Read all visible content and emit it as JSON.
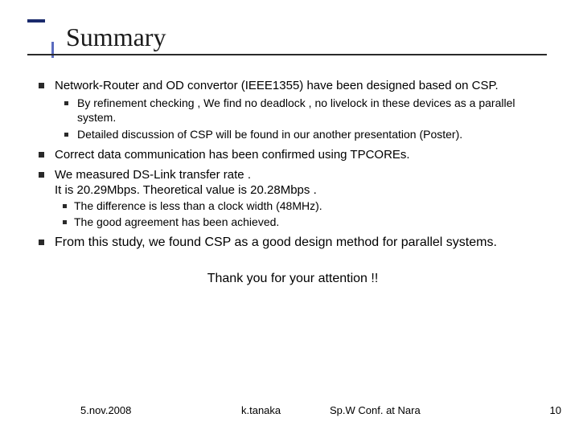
{
  "title": "Summary",
  "bullets": {
    "b1": "Network-Router and OD convertor (IEEE1355) have been designed based on CSP.",
    "b1a": "By refinement checking , We find no deadlock , no livelock in these devices as a parallel system.",
    "b1b": "Detailed discussion of CSP will be found in our another presentation (Poster).",
    "b2": "Correct data communication has been confirmed using TPCOREs.",
    "b3": "We measured DS-Link transfer rate .",
    "b3line2": "It is 20.29Mbps. Theoretical value is 20.28Mbps .",
    "b3a": "The difference is less than a clock width (48MHz).",
    "b3b": "The good agreement has been achieved.",
    "b4": "From this study, we found CSP as a good design method for parallel systems."
  },
  "thanks": "Thank you for your attention !!",
  "footer": {
    "date": "5.nov.2008",
    "author": "k.tanaka",
    "conf": "Sp.W Conf. at Nara",
    "page": "10"
  }
}
